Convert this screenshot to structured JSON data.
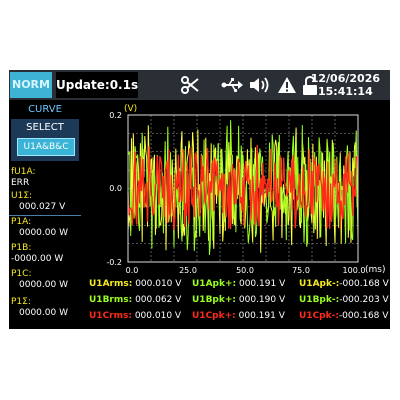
{
  "header": {
    "mode_label": "NORM",
    "update_label": "Update:0.1s",
    "date": "12/06/2026",
    "time": "15:41:14",
    "icons": [
      "scissors-icon",
      "usb-icon",
      "speaker-icon",
      "warning-icon",
      "unlock-icon"
    ]
  },
  "sidebar": {
    "curve_label": "CURVE",
    "select_label": "SELECT",
    "channel_button": "U1A&B&C",
    "values": [
      {
        "label": "fU1A:",
        "value": "ERR"
      },
      {
        "label": "U1Σ:",
        "value": "000.027 V"
      },
      {
        "label": "P1A:",
        "value": "0000.00 W"
      },
      {
        "label": "P1B:",
        "value": "-0000.00 W"
      },
      {
        "label": "P1C:",
        "value": "0000.00 W"
      },
      {
        "label": "P1Σ:",
        "value": "0000.00 W"
      }
    ]
  },
  "chart_data": {
    "type": "line",
    "ylabel": "(V)",
    "xlabel": "(ms)",
    "xlim": [
      0,
      100
    ],
    "ylim": [
      -0.2,
      0.2
    ],
    "xticks": [
      "0.0",
      "25.0",
      "50.0",
      "75.0",
      "100.0"
    ],
    "yticks": [
      "0.2",
      "0.0",
      "-0.2"
    ],
    "grid": true,
    "series": [
      {
        "name": "U1A",
        "color": "#9bff1e",
        "amplitude": 0.19
      },
      {
        "name": "U1B",
        "color": "#ffff40",
        "amplitude": 0.19
      },
      {
        "name": "U1C",
        "color": "#ff2a1a",
        "amplitude": 0.13
      }
    ]
  },
  "readings": [
    [
      {
        "name": "U1Arms:",
        "value": "000.010 V",
        "color": "#f6ea20"
      },
      {
        "name": "U1Apk+:",
        "value": "000.191 V",
        "color": "#9bff1e"
      },
      {
        "name": "U1Apk-:",
        "value": "-000.168 V",
        "color": "#f6ea20"
      }
    ],
    [
      {
        "name": "U1Brms:",
        "value": "000.062 V",
        "color": "#9bff1e"
      },
      {
        "name": "U1Bpk+:",
        "value": "000.190 V",
        "color": "#9bff1e"
      },
      {
        "name": "U1Bpk-:",
        "value": "-000.203 V",
        "color": "#9bff1e"
      }
    ],
    [
      {
        "name": "U1Crms:",
        "value": "000.010 V",
        "color": "#ff2a1a"
      },
      {
        "name": "U1Cpk+:",
        "value": "000.191 V",
        "color": "#ff2a1a"
      },
      {
        "name": "U1Cpk-:",
        "value": "-000.168 V",
        "color": "#ff2a1a"
      }
    ]
  ]
}
